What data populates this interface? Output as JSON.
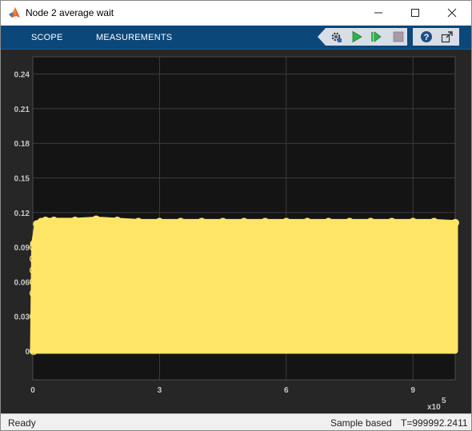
{
  "window": {
    "title": "Node 2 average wait",
    "app_icon": "matlab-logo-icon",
    "controls": [
      "minimize-icon",
      "maximize-icon",
      "close-icon"
    ]
  },
  "toolstrip": {
    "tabs": [
      {
        "label": "SCOPE"
      },
      {
        "label": "MEASUREMENTS"
      }
    ],
    "tools": [
      {
        "icon": "settings-gear-icon"
      },
      {
        "icon": "run-play-icon"
      },
      {
        "icon": "step-forward-icon"
      },
      {
        "icon": "stop-icon"
      },
      {
        "icon": "help-icon"
      },
      {
        "icon": "undock-icon"
      }
    ]
  },
  "scope": {
    "background": "#141414",
    "trace_color": "#ffe566",
    "x_exponent": "x10",
    "x_exponent_power": "5"
  },
  "chart_data": {
    "type": "scatter",
    "title": "",
    "xlabel": "",
    "ylabel": "",
    "xlim": [
      0,
      10
    ],
    "ylim": [
      -0.025,
      0.255
    ],
    "x_ticks": [
      "0",
      "3",
      "6",
      "9"
    ],
    "x_tick_values": [
      0,
      3,
      6,
      9
    ],
    "y_ticks": [
      "0",
      "0.03",
      "0.06",
      "0.09",
      "0.12",
      "0.15",
      "0.18",
      "0.21",
      "0.24"
    ],
    "y_tick_values": [
      0,
      0.03,
      0.06,
      0.09,
      0.12,
      0.15,
      0.18,
      0.21,
      0.24
    ],
    "x_multiplier": "x10^5",
    "grid": true,
    "series": [
      {
        "x": [
          0,
          0.03,
          0.1,
          0.2,
          0.3,
          0.5,
          1,
          1.5,
          2,
          2.5,
          3,
          3.5,
          4,
          4.5,
          5,
          5.5,
          6,
          6.5,
          7,
          7.5,
          8,
          8.5,
          9,
          9.5,
          10
        ],
        "y_upper": [
          0.0,
          0.093,
          0.11,
          0.112,
          0.113,
          0.113,
          0.113,
          0.114,
          0.113,
          0.112,
          0.112,
          0.112,
          0.112,
          0.112,
          0.112,
          0.112,
          0.112,
          0.112,
          0.112,
          0.112,
          0.112,
          0.112,
          0.112,
          0.112,
          0.111
        ],
        "y_lower": 0
      }
    ]
  },
  "status": {
    "left": "Ready",
    "mode": "Sample based",
    "time": "T=999992.2411"
  }
}
